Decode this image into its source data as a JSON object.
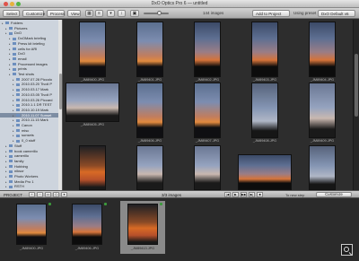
{
  "window": {
    "title": "DxO Optics Pro 6 — untitled"
  },
  "toolbar": {
    "select_label": "Select",
    "customize_label": "Customize",
    "process_label": "Process",
    "view_label": "View",
    "image_count": "144 images",
    "add_to_project_label": "Add to Project",
    "using_preset_label": "Using preset",
    "preset_value": "DxO Default v6"
  },
  "sidebar": {
    "items": [
      {
        "label": "Folders",
        "indent": 0,
        "selected": false
      },
      {
        "label": "Pictures",
        "indent": 1,
        "selected": false
      },
      {
        "label": "DxO",
        "indent": 1,
        "selected": false
      },
      {
        "label": "DxOMark briefing",
        "indent": 2,
        "selected": false
      },
      {
        "label": "Press kit briefing",
        "indent": 2,
        "selected": false
      },
      {
        "label": "cells for ARI",
        "indent": 2,
        "selected": false
      },
      {
        "label": "DxO",
        "indent": 2,
        "selected": false
      },
      {
        "label": "email",
        "indent": 2,
        "selected": false
      },
      {
        "label": "Processed images",
        "indent": 2,
        "selected": false
      },
      {
        "label": "prints",
        "indent": 2,
        "selected": false
      },
      {
        "label": "Test shots",
        "indent": 2,
        "selected": false
      },
      {
        "label": "2007.07.28 Piccolo",
        "indent": 3,
        "selected": false
      },
      {
        "label": "2010.03.20 Tivoli P",
        "indent": 3,
        "selected": false
      },
      {
        "label": "2010.03.17 Mark",
        "indent": 3,
        "selected": false
      },
      {
        "label": "2010.03.05 Tivoli P",
        "indent": 3,
        "selected": false
      },
      {
        "label": "2010.03.26 Piccard",
        "indent": 3,
        "selected": false
      },
      {
        "label": "2010.1.1 DR TEST",
        "indent": 3,
        "selected": false
      },
      {
        "label": "2010.10.19 Mark",
        "indent": 3,
        "selected": false
      },
      {
        "label": "2010.11.07 Sunset",
        "indent": 3,
        "selected": true
      },
      {
        "label": "2010.11.15 Mark",
        "indent": 3,
        "selected": false
      },
      {
        "label": "Canon",
        "indent": 3,
        "selected": false
      },
      {
        "label": "misc",
        "indent": 3,
        "selected": false
      },
      {
        "label": "sunsets",
        "indent": 3,
        "selected": false
      },
      {
        "label": "0_0 stuff",
        "indent": 3,
        "selected": false
      },
      {
        "label": "Stuff",
        "indent": 1,
        "selected": false
      },
      {
        "label": "book camerillo",
        "indent": 1,
        "selected": false
      },
      {
        "label": "camerillo",
        "indent": 1,
        "selected": false
      },
      {
        "label": "family",
        "indent": 1,
        "selected": false
      },
      {
        "label": "Hobbing",
        "indent": 1,
        "selected": false
      },
      {
        "label": "niksor",
        "indent": 1,
        "selected": false
      },
      {
        "label": "Photo Workers",
        "indent": 1,
        "selected": false
      },
      {
        "label": "Media Pro 1",
        "indent": 1,
        "selected": false
      },
      {
        "label": "RSTH",
        "indent": 1,
        "selected": false
      }
    ]
  },
  "grid": {
    "items": [
      {
        "name": "_JM89400.JPG",
        "style": "sky-a"
      },
      {
        "name": "_JM89401.JPG",
        "style": "sky-a"
      },
      {
        "name": "_JM89402.JPG",
        "style": "sky-b"
      },
      {
        "name": "_JM89403.JPG",
        "style": "sky-b"
      },
      {
        "name": "_JM89404.JPG",
        "style": "sky-b"
      },
      {
        "name": "_JM89405.JPG",
        "style": "sky-c"
      },
      {
        "name": "_JM89406.JPG",
        "style": "sky-a"
      },
      {
        "name": "_JM89407.JPG",
        "style": "sky-a"
      },
      {
        "name": "_JM89408.JPG",
        "style": "sky-f"
      },
      {
        "name": "_JM89409.JPG",
        "style": "sky-c"
      },
      {
        "name": "_JM89410.JPG",
        "style": "sky-d"
      },
      {
        "name": "_JM89411.JPG",
        "style": "sky-c"
      },
      {
        "name": "_JM89412.JPG",
        "style": "sky-c"
      },
      {
        "name": "_JM89413.JPG",
        "style": "sky-b"
      },
      {
        "name": "_JM89414.JPG",
        "style": "sky-f"
      }
    ]
  },
  "project": {
    "label": "PROJECT",
    "count": "3/3 images",
    "status": "To new step",
    "customize_label": "Customize",
    "play_controls": [
      "|◀",
      "▶",
      "▶▶",
      "▶|",
      "■"
    ],
    "items": [
      {
        "name": "_JM89400.JPG",
        "style": "sky-a",
        "selected": false
      },
      {
        "name": "_JM89406.JPG",
        "style": "sky-b",
        "selected": false
      },
      {
        "name": "_JM89413.JPG",
        "style": "sky-d",
        "selected": true
      }
    ]
  },
  "icons": {
    "grid_view": "grid-view-icon",
    "list_view": "list-view-icon",
    "filter": "filter-icon",
    "zoom": "zoom-icon",
    "folder": "folder-icon"
  }
}
